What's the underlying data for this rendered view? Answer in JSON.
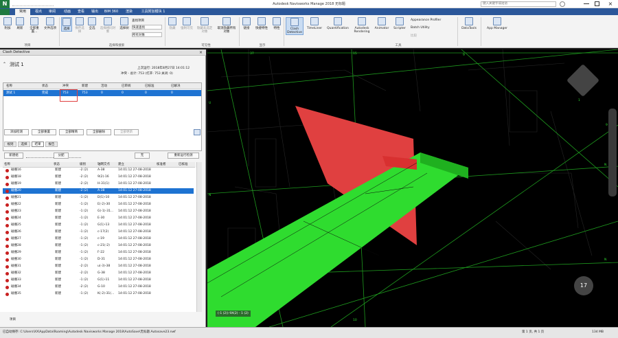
{
  "app": {
    "title": "Autodesk Navisworks Manage 2018   无标题",
    "logo": "N",
    "search_placeholder": "键入关键字或短语"
  },
  "tabs": [
    "常用",
    "视点",
    "审阅",
    "动画",
    "查看",
    "输出",
    "BIM 360",
    "渲染",
    "工具附加模块 1"
  ],
  "active_tab": "常用",
  "ribbon": {
    "buttons": [
      {
        "label": "附加",
        "icon": "append-icon"
      },
      {
        "label": "刷新",
        "icon": "refresh-icon"
      },
      {
        "label": "全部重置...",
        "icon": "reset-icon"
      },
      {
        "label": "文件选项",
        "icon": "file-options-icon"
      },
      {
        "label": "选择",
        "icon": "select-icon"
      },
      {
        "label": "保存选择",
        "icon": "save-selection-icon"
      },
      {
        "label": "全选",
        "icon": "select-all-icon"
      },
      {
        "label": "选择相同对象",
        "icon": "select-same-icon"
      },
      {
        "label": "选择树",
        "icon": "selection-tree-icon"
      },
      {
        "label": "隐藏",
        "icon": "hide-icon"
      },
      {
        "label": "强制可见",
        "icon": "require-icon"
      },
      {
        "label": "隐藏未选定对象",
        "icon": "hide-unselected-icon"
      },
      {
        "label": "取消隐藏所有对象",
        "icon": "unhide-all-icon"
      },
      {
        "label": "链接",
        "icon": "links-icon"
      },
      {
        "label": "快捷特性",
        "icon": "quick-properties-icon"
      },
      {
        "label": "特性",
        "icon": "properties-icon"
      },
      {
        "label": "Clash Detective",
        "icon": "clash-detective-icon"
      },
      {
        "label": "TimeLiner",
        "icon": "timeliner-icon"
      },
      {
        "label": "Quantification",
        "icon": "quantification-icon"
      },
      {
        "label": "Autodesk Rendering",
        "icon": "rendering-icon"
      },
      {
        "label": "Animator",
        "icon": "animator-icon"
      },
      {
        "label": "Scripter",
        "icon": "scripter-icon"
      },
      {
        "label": "DataTools",
        "icon": "datatools-icon"
      },
      {
        "label": "App Manager",
        "icon": "app-manager-icon"
      }
    ],
    "small": [
      "查找项目",
      "快速查找",
      "Appearance Profiler",
      "Batch Utility",
      "比较"
    ],
    "dropdown": "所有对象",
    "groups": [
      "项目",
      "选择和搜索",
      "可见性",
      "显示",
      "工具"
    ]
  },
  "panel": {
    "title": "Clash Detective",
    "test_name": "测试 1",
    "last_run": "上次运行: 2018年8月27日 14:01:12",
    "summary": "冲突 - 总计: 753 (打开: 753 关闭: 0)",
    "test_headers": [
      "名称",
      "状态",
      "冲突",
      "新建",
      "活动",
      "已审阅",
      "已核准",
      "已解决"
    ],
    "test_row": [
      "测试 1",
      "完成",
      "753",
      "753",
      "0",
      "0",
      "0",
      "0"
    ],
    "actions": [
      "添加检测",
      "全部重置",
      "全部精简",
      "全部删除",
      "全部更新"
    ],
    "subtabs": [
      "规则",
      "选择",
      "结果",
      "报告"
    ],
    "active_subtab": "结果",
    "results_toolbar": [
      "新建组",
      "分配",
      "无",
      "重新运行检测"
    ],
    "columns": [
      "名称",
      "",
      "状态",
      "级别",
      "轴网交点",
      "建立",
      "核准者",
      "已核准"
    ],
    "rows": [
      [
        "碰撞16",
        "新建",
        "-2 (2)",
        "A-38",
        "14:01:12 27-08-2018"
      ],
      [
        "碰撞18",
        "新建",
        "-2 (2)",
        "9(2)-16",
        "14:01:12 27-08-2018"
      ],
      [
        "碰撞19",
        "新建",
        "-2 (2)",
        "H-31(1)",
        "14:01:12 27-08-2018"
      ],
      [
        "碰撞20",
        "新建",
        "-2 (2)",
        "A-38",
        "14:01:12 27-08-2018"
      ],
      [
        "碰撞21",
        "新建",
        "-1 (2)",
        "D(1)-10",
        "14:01:12 27-08-2018"
      ],
      [
        "碰撞22",
        "新建",
        "-1 (2)",
        "E(-2)-30",
        "14:01:12 27-08-2018"
      ],
      [
        "碰撞23",
        "新建",
        "-1 (2)",
        "G(-1)-31...",
        "14:01:12 27-08-2018"
      ],
      [
        "碰撞24",
        "新建",
        "-1 (2)",
        "E-30",
        "14:01:12 27-08-2018"
      ],
      [
        "碰撞25",
        "新建",
        "-1 (2)",
        "G(1)-13",
        "14:01:12 27-08-2018"
      ],
      [
        "碰撞26",
        "新建",
        "-1 (2)",
        "c-17(2)",
        "14:01:12 27-08-2018"
      ],
      [
        "碰撞27",
        "新建",
        "-1 (2)",
        "c-19",
        "14:01:12 27-08-2018"
      ],
      [
        "碰撞28",
        "新建",
        "-1 (2)",
        "c-21(-2)",
        "14:01:12 27-08-2018"
      ],
      [
        "碰撞29",
        "新建",
        "-1 (2)",
        "F-22",
        "14:01:12 27-08-2018"
      ],
      [
        "碰撞30",
        "新建",
        "-1 (2)",
        "D-31",
        "14:01:12 27-08-2018"
      ],
      [
        "碰撞31",
        "新建",
        "-2 (2)",
        "u(-3)-38",
        "14:01:12 27-08-2018"
      ],
      [
        "碰撞32",
        "新建",
        "-2 (2)",
        "G-38",
        "14:01:12 27-08-2018"
      ],
      [
        "碰撞33",
        "新建",
        "-1 (2)",
        "G(1)-11",
        "14:01:12 27-08-2018"
      ],
      [
        "碰撞34",
        "新建",
        "-2 (2)",
        "G-10",
        "14:01:12 27-08-2018"
      ],
      [
        "碰撞35",
        "新建",
        "-1 (2)",
        "K(-2)-31(...",
        "14:01:12 27-08-2018"
      ]
    ],
    "selected_row": 3,
    "footer": "项目"
  },
  "viewport": {
    "tag": "(-1 (2)) 9X(2) - 1 (2)",
    "compass": "17",
    "grid_labels": [
      "37",
      "U",
      "15",
      "9",
      "N",
      "N",
      "10",
      "N",
      "9",
      "1"
    ],
    "colors": {
      "red_element": "#e04040",
      "green_element": "#2fdc2f",
      "grid": "#1e9a1e"
    }
  },
  "status": {
    "path": "已自动保存: C:\\Users\\XX\\AppData\\Roaming\\Autodesk Navisworks Manage 2018\\AutoSave\\无标题.Autosave23.nwf",
    "page": "第 1 页, 共 1 页",
    "mem": "134 MB"
  }
}
